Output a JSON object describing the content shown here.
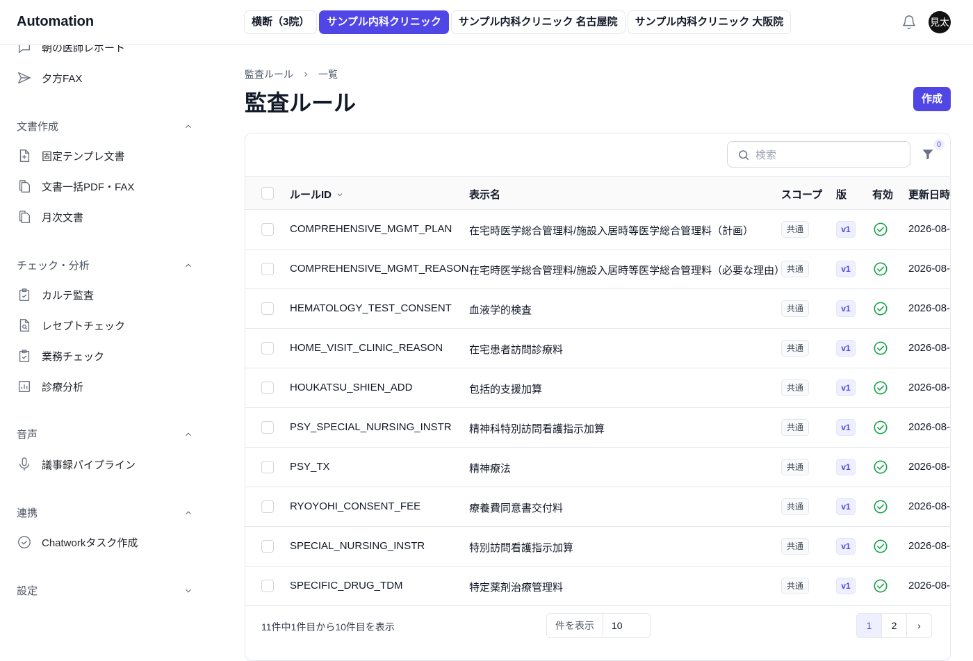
{
  "app": {
    "brand": "Automation",
    "avatar": "見太"
  },
  "clinic_tabs": [
    {
      "label": "横断（3院）"
    },
    {
      "label": "サンプル内科クリニック"
    },
    {
      "label": "サンプル内科クリニック 名古屋院"
    },
    {
      "label": "サンプル内科クリニック 大阪院"
    }
  ],
  "sidebar": {
    "top_items": [
      {
        "label": "朝の医師レポート",
        "icon": "chat-icon"
      },
      {
        "label": "夕方FAX",
        "icon": "send-icon"
      }
    ],
    "sections": [
      {
        "title": "文書作成",
        "expanded": true,
        "items": [
          {
            "label": "固定テンプレ文書",
            "icon": "file-plus-icon"
          },
          {
            "label": "文書一括PDF・FAX",
            "icon": "files-icon"
          },
          {
            "label": "月次文書",
            "icon": "files-icon"
          }
        ]
      },
      {
        "title": "チェック・分析",
        "expanded": true,
        "items": [
          {
            "label": "カルテ監査",
            "icon": "clipboard-check-icon"
          },
          {
            "label": "レセプトチェック",
            "icon": "file-search-icon"
          },
          {
            "label": "業務チェック",
            "icon": "clipboard-check-icon"
          },
          {
            "label": "診療分析",
            "icon": "bar-chart-icon"
          }
        ]
      },
      {
        "title": "音声",
        "expanded": true,
        "items": [
          {
            "label": "議事録パイプライン",
            "icon": "mic-icon"
          }
        ]
      },
      {
        "title": "連携",
        "expanded": true,
        "items": [
          {
            "label": "Chatworkタスク作成",
            "icon": "check-circle-icon"
          }
        ]
      },
      {
        "title": "設定",
        "expanded": false,
        "items": []
      }
    ]
  },
  "main": {
    "breadcrumb": [
      "監査ルール",
      "一覧"
    ],
    "title": "監査ルール",
    "create_label": "作成",
    "search_placeholder": "検索",
    "filter_count": "0",
    "columns": {
      "rule_id": "ルールID",
      "display_name": "表示名",
      "scope": "スコープ",
      "version": "版",
      "enabled": "有効",
      "updated": "更新日時"
    },
    "rows": [
      {
        "rule_id": "COMPREHENSIVE_MGMT_PLAN",
        "name": "在宅時医学総合管理料/施設入居時等医学総合管理料（計画）",
        "scope": "共通",
        "version": "v1",
        "date": "2026-08-"
      },
      {
        "rule_id": "COMPREHENSIVE_MGMT_REASON",
        "name": "在宅時医学総合管理料/施設入居時等医学総合管理料（必要な理由）",
        "scope": "共通",
        "version": "v1",
        "date": "2026-08-"
      },
      {
        "rule_id": "HEMATOLOGY_TEST_CONSENT",
        "name": "血液学的検査",
        "scope": "共通",
        "version": "v1",
        "date": "2026-08-"
      },
      {
        "rule_id": "HOME_VISIT_CLINIC_REASON",
        "name": "在宅患者訪問診療料",
        "scope": "共通",
        "version": "v1",
        "date": "2026-08-"
      },
      {
        "rule_id": "HOUKATSU_SHIEN_ADD",
        "name": "包括的支援加算",
        "scope": "共通",
        "version": "v1",
        "date": "2026-08-"
      },
      {
        "rule_id": "PSY_SPECIAL_NURSING_INSTR",
        "name": "精神科特別訪問看護指示加算",
        "scope": "共通",
        "version": "v1",
        "date": "2026-08-"
      },
      {
        "rule_id": "PSY_TX",
        "name": "精神療法",
        "scope": "共通",
        "version": "v1",
        "date": "2026-08-"
      },
      {
        "rule_id": "RYOYOHI_CONSENT_FEE",
        "name": "療養費同意書交付料",
        "scope": "共通",
        "version": "v1",
        "date": "2026-08-"
      },
      {
        "rule_id": "SPECIAL_NURSING_INSTR",
        "name": "特別訪問看護指示加算",
        "scope": "共通",
        "version": "v1",
        "date": "2026-08-"
      },
      {
        "rule_id": "SPECIFIC_DRUG_TDM",
        "name": "特定薬剤治療管理料",
        "scope": "共通",
        "version": "v1",
        "date": "2026-08-"
      }
    ],
    "footer": {
      "summary": "11件中1件目から10件目を表示",
      "per_page_label": "件を表示",
      "per_page_value": "10",
      "pages": [
        "1",
        "2",
        "›"
      ]
    }
  },
  "colors": {
    "accent": "#5046e5",
    "success": "#16a34a"
  }
}
